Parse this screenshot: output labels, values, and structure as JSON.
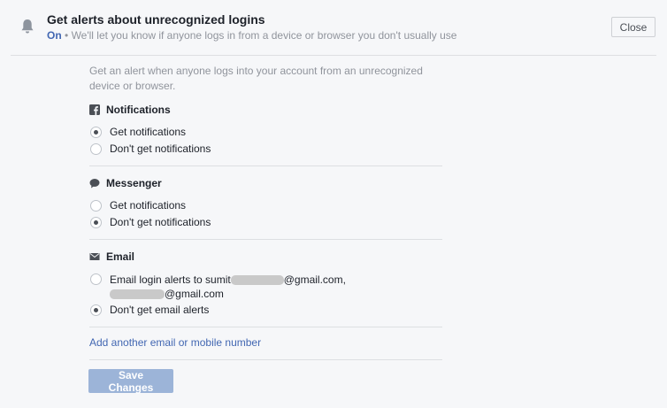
{
  "header": {
    "title": "Get alerts about unrecognized logins",
    "status": "On",
    "separator": "•",
    "description": "We'll let you know if anyone logs in from a device or browser you don't usually use",
    "close_label": "Close"
  },
  "intro": "Get an alert when anyone logs into your account from an unrecognized device or browser.",
  "sections": {
    "notifications": {
      "label": "Notifications",
      "icon": "facebook-icon",
      "options": [
        "Get notifications",
        "Don't get notifications"
      ],
      "selected": 0
    },
    "messenger": {
      "label": "Messenger",
      "icon": "chat-bubble-icon",
      "options": [
        "Get notifications",
        "Don't get notifications"
      ],
      "selected": 1
    },
    "email": {
      "label": "Email",
      "icon": "envelope-icon",
      "option1_prefix": "Email login alerts to sumit",
      "option1_mid": "@gmail.com,",
      "option1_suffix": "@gmail.com",
      "option2": "Don't get email alerts",
      "selected": 1
    }
  },
  "add_link": "Add another email or mobile number",
  "save_label": "Save Changes",
  "colors": {
    "accent": "#4267b2",
    "save_disabled": "#9cb4d8",
    "muted_text": "#90949c",
    "background": "#f6f7f9"
  }
}
